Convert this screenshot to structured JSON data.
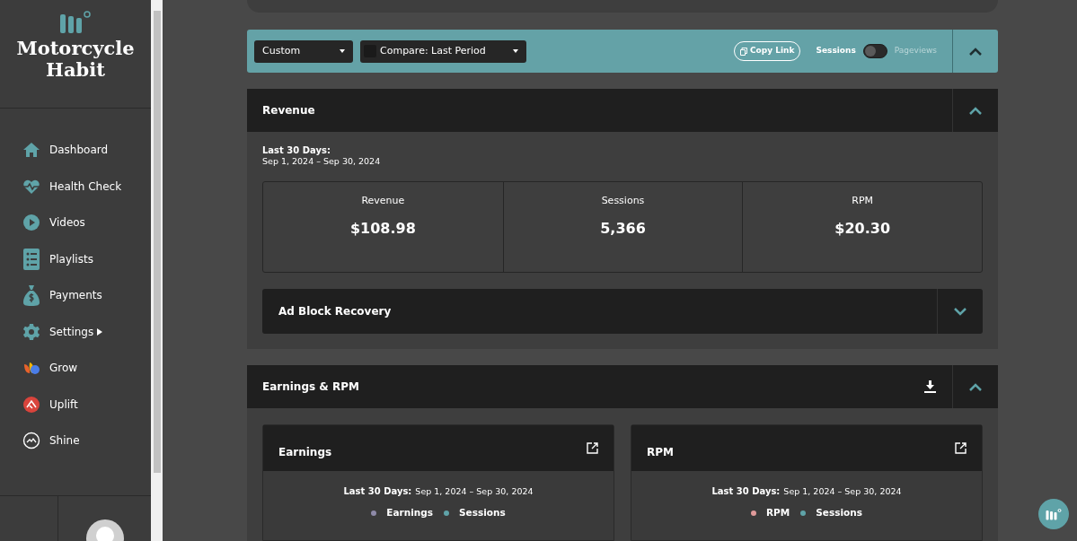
{
  "sidebar": {
    "brand": "Motorcycle Habit",
    "items": [
      {
        "label": "Dashboard",
        "has_submenu": false
      },
      {
        "label": "Health Check",
        "has_submenu": false
      },
      {
        "label": "Videos",
        "has_submenu": false
      },
      {
        "label": "Playlists",
        "has_submenu": false
      },
      {
        "label": "Payments",
        "has_submenu": false
      },
      {
        "label": "Settings",
        "has_submenu": true
      },
      {
        "label": "Grow",
        "has_submenu": false
      },
      {
        "label": "Uplift",
        "has_submenu": false
      },
      {
        "label": "Shine",
        "has_submenu": false
      }
    ]
  },
  "toolbar": {
    "range": "Custom",
    "compare": "Compare: Last Period",
    "copy_link": "Copy Link",
    "toggle": {
      "left": "Sessions",
      "right": "Pageviews",
      "on": false
    }
  },
  "revenue": {
    "title": "Revenue",
    "expanded": true,
    "period_label": "Last 30 Days:",
    "period": "Sep 1, 2024 – Sep 30, 2024",
    "metrics": [
      {
        "label": "Revenue",
        "value": "$108.98"
      },
      {
        "label": "Sessions",
        "value": "5,366"
      },
      {
        "label": "RPM",
        "value": "$20.30"
      }
    ],
    "ad_block": {
      "title": "Ad Block Recovery",
      "expanded": false
    }
  },
  "earnings_rpm": {
    "title": "Earnings & RPM",
    "expanded": true,
    "cards": [
      {
        "title": "Earnings",
        "period_label": "Last 30 Days:",
        "period": "Sep 1, 2024 – Sep 30, 2024",
        "legend": [
          {
            "label": "Earnings",
            "color": "#8e8aa8"
          },
          {
            "label": "Sessions",
            "color": "#5fa3a8"
          }
        ]
      },
      {
        "title": "RPM",
        "period_label": "Last 30 Days:",
        "period": "Sep 1, 2024 – Sep 30, 2024",
        "legend": [
          {
            "label": "RPM",
            "color": "#e09a9a"
          },
          {
            "label": "Sessions",
            "color": "#5fa3a8"
          }
        ]
      }
    ]
  }
}
